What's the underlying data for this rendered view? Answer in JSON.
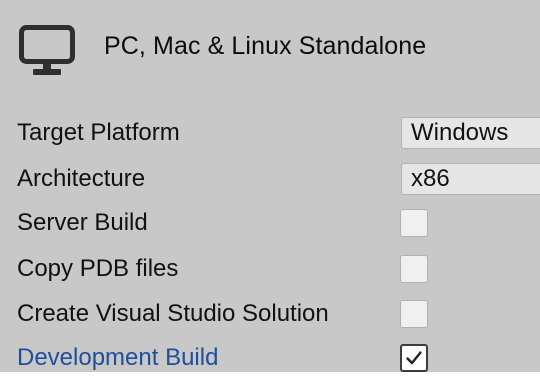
{
  "header": {
    "icon": "monitor-icon",
    "title": "PC, Mac & Linux Standalone"
  },
  "settings": {
    "target_platform": {
      "label": "Target Platform",
      "value": "Windows"
    },
    "architecture": {
      "label": "Architecture",
      "value": "x86"
    },
    "server_build": {
      "label": "Server Build",
      "checked": false
    },
    "copy_pdb_files": {
      "label": "Copy PDB files",
      "checked": false
    },
    "create_vs_solution": {
      "label": "Create Visual Studio Solution",
      "checked": false
    },
    "development_build": {
      "label": "Development Build",
      "checked": true
    }
  },
  "colors": {
    "panel_background": "#c8c8c8",
    "highlight_label": "#1f4e9b"
  }
}
